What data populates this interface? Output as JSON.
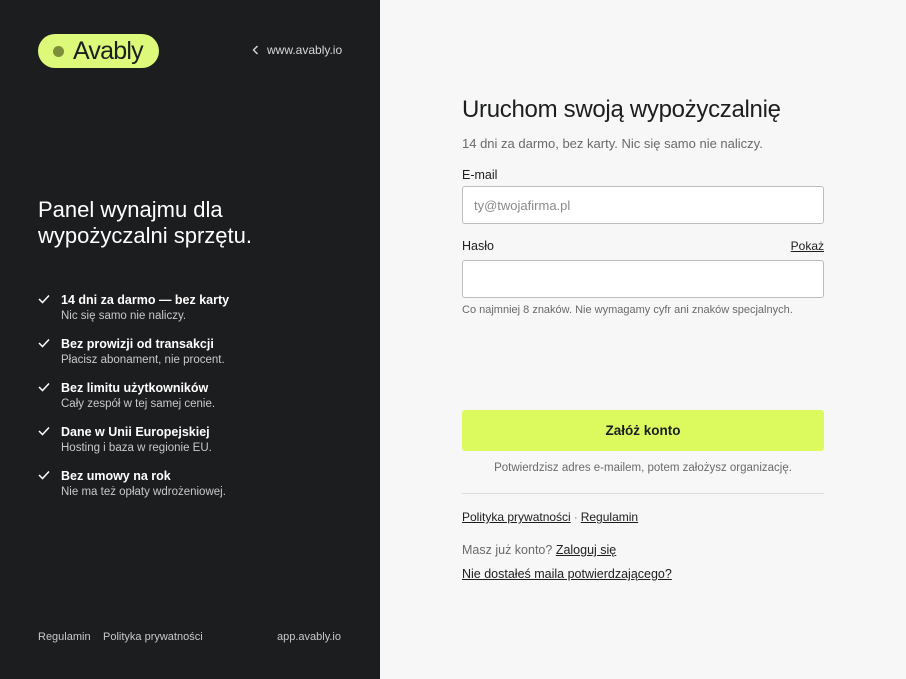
{
  "brand": {
    "name": "Avably",
    "accent_color": "#dcf97a",
    "dark_bg": "#1c1d1f"
  },
  "left_panel": {
    "site_link": "www.avably.io",
    "headline": "Panel wynajmu dla wypożyczalni sprzętu.",
    "features": [
      {
        "title": "14 dni za darmo — bez karty",
        "subtitle": "Nic się samo nie naliczy."
      },
      {
        "title": "Bez prowizji od transakcji",
        "subtitle": "Płacisz abonament, nie procent."
      },
      {
        "title": "Bez limitu użytkowników",
        "subtitle": "Cały zespół w tej samej cenie."
      },
      {
        "title": "Dane w Unii Europejskiej",
        "subtitle": "Hosting i baza w regionie EU."
      },
      {
        "title": "Bez umowy na rok",
        "subtitle": "Nie ma też opłaty wdrożeniowej."
      }
    ],
    "footer": {
      "terms": "Regulamin",
      "privacy": "Polityka prywatności",
      "app_link": "app.avably.io"
    }
  },
  "form": {
    "title": "Uruchom swoją wypożyczalnię",
    "subtitle": "14 dni za darmo, bez karty. Nic się samo nie naliczy.",
    "email_label": "E-mail",
    "email_placeholder": "ty@twojafirma.pl",
    "email_value": "",
    "password_label": "Hasło",
    "show_password": "Pokaż",
    "password_value": "",
    "password_hint": "Co najmniej 8 znaków. Nie wymagamy cyfr ani znaków specjalnych.",
    "submit_label": "Załóż konto",
    "confirm_note": "Potwierdzisz adres e-mailem, potem założysz organizację.",
    "privacy_link": "Polityka prywatności",
    "legal_separator": "·",
    "terms_link": "Regulamin",
    "login_prompt": "Masz już konto?",
    "login_link": "Zaloguj się",
    "resend_link": "Nie dostałeś maila potwierdzającego?"
  }
}
